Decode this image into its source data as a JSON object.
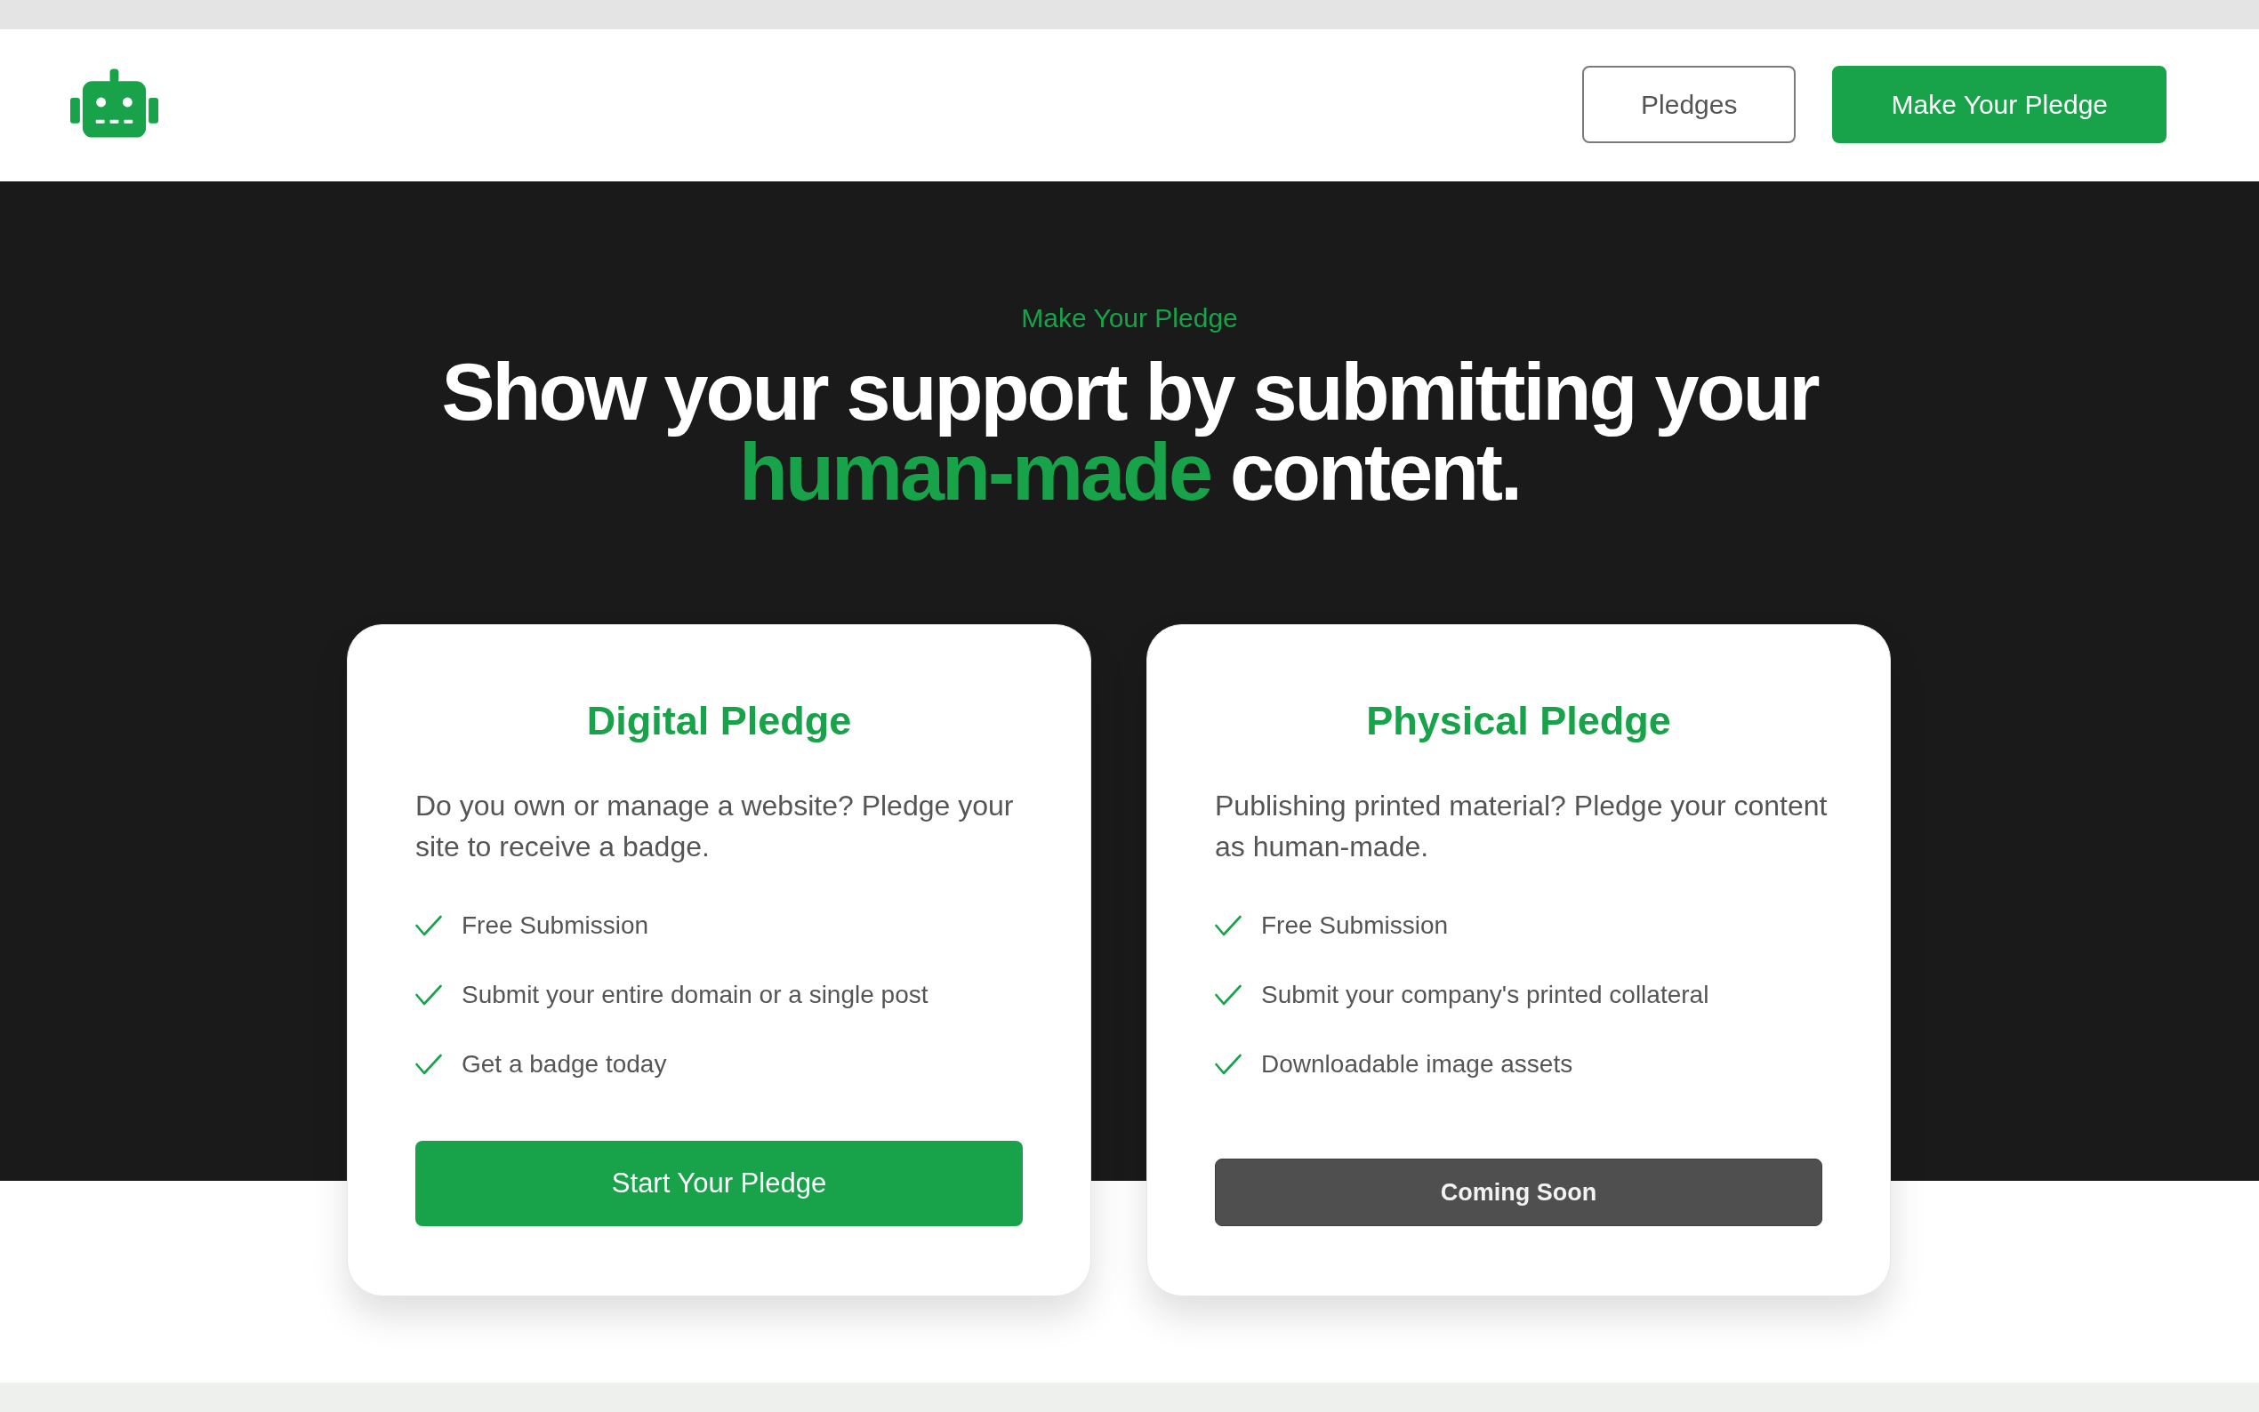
{
  "header": {
    "buttons": [
      {
        "label": "Pledges",
        "kind": "outline"
      },
      {
        "label": "Make Your Pledge",
        "kind": "primary"
      }
    ]
  },
  "hero": {
    "eyebrow": "Make Your Pledge",
    "headline": [
      {
        "text": "Show your support by submitting your ",
        "highlight": false
      },
      {
        "text": "human-made",
        "highlight": true
      },
      {
        "text": " content.",
        "highlight": false
      }
    ]
  },
  "cards": [
    {
      "title": "Digital Pledge",
      "description": "Do you own or manage a website? Pledge your site to receive a badge.",
      "features": [
        "Free Submission",
        "Submit your entire domain or a single post",
        "Get a badge today"
      ],
      "button": {
        "label": "Start Your Pledge",
        "disabled": false
      }
    },
    {
      "title": "Physical Pledge",
      "description": "Publishing printed material? Pledge your content as human-made.",
      "features": [
        "Free Submission",
        "Submit your company's printed collateral",
        "Downloadable image assets"
      ],
      "button": {
        "label": "Coming Soon",
        "disabled": true
      }
    }
  ]
}
